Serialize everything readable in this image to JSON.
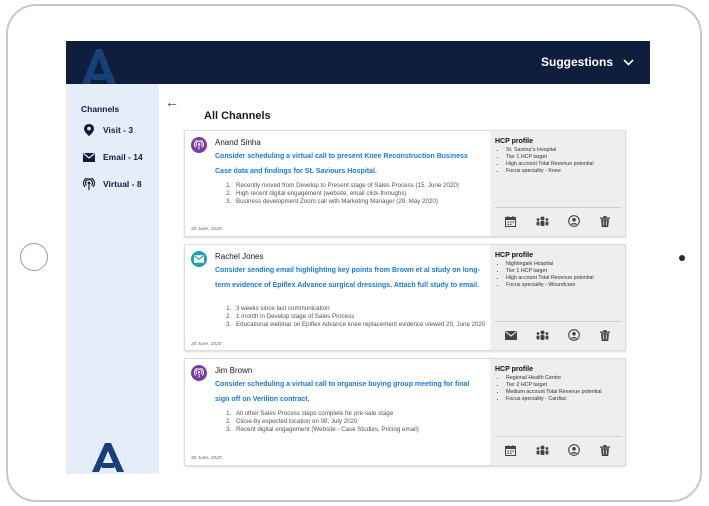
{
  "header": {
    "suggestions_label": "Suggestions"
  },
  "sidebar": {
    "title": "Channels",
    "items": [
      {
        "label": "Visit - 3",
        "icon": "location-pin-icon"
      },
      {
        "label": "Email - 14",
        "icon": "envelope-icon"
      },
      {
        "label": "Virtual - 8",
        "icon": "broadcast-icon"
      }
    ]
  },
  "main": {
    "title": "All Channels"
  },
  "cards": [
    {
      "name": "Anand Sinha",
      "channel": "virtual",
      "message": "Consider scheduling a virtual call to present Knee Reconstruction Business Case data and findings for St. Saviours Hospital.",
      "reasons": [
        "Recently moved from Develop to Present stage of Sales Process (15, June 2020)",
        "High recent digital engagement (website, email click-throughs)",
        "Business development Zoom call with Marketing Manager (29, May 2020)"
      ],
      "date": "30 June, 2020",
      "hcp_title": "HCP profile",
      "hcp": [
        "St. Saviour's Hospital",
        "Tier 1 HCP target",
        "High account Total Revenue potential",
        "Focus speciality - Knee"
      ]
    },
    {
      "name": "Rachel Jones",
      "channel": "email",
      "message": "Consider sending email highlighting key points from Brown et al study on long-term evidence of Epiflex Advance surgical dressings. Attach full study to email.",
      "reasons": [
        "3 weeks since last communication",
        "1 month in Develop stage of Sales Process",
        "Educational webinar on Epiflex Advance knee replacement evidence viewed 20, June 2020"
      ],
      "date": "30 June, 2020",
      "hcp_title": "HCP profile",
      "hcp": [
        "Nightingale Hospital",
        "Tier 1 HCP target",
        "High account Total Revenue potential",
        "Focus speciality - Woundcare"
      ]
    },
    {
      "name": "Jim Brown",
      "channel": "virtual",
      "message": "Consider scheduling a virtual call to organise buying group meeting for final sign off on Verilion contract.",
      "reasons": [
        "All other Sales Process steps complete for pre-sale stage",
        "Close-by expected location on 08, July 2020",
        "Recent digital engagement (Website - Case Studies, Pricing email)"
      ],
      "date": "30 June, 2020",
      "hcp_title": "HCP profile",
      "hcp": [
        "Regional Health Centre",
        "Tier 2 HCP target",
        "Medium account Total Revenue potential",
        "Focus speciality - Cardiac"
      ]
    }
  ],
  "colors": {
    "header_bg": "#0e1e3c",
    "sidebar_bg": "#e4edf8",
    "link_blue": "#1a7ad8",
    "virtual_badge": "#7b3aa0",
    "email_badge": "#1aa3b0"
  }
}
